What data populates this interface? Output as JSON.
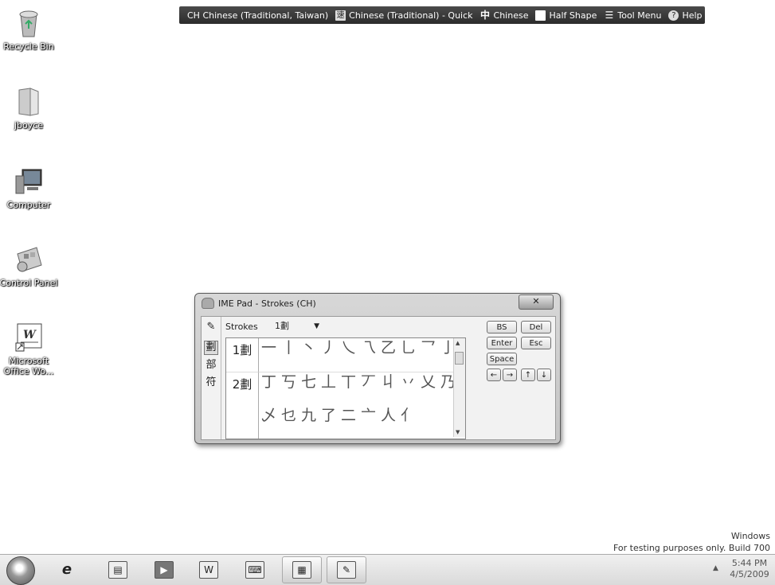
{
  "desktop": {
    "icons": [
      {
        "label": "Recycle Bin",
        "icon": "recycle-bin-icon"
      },
      {
        "label": "jboyce",
        "icon": "user-folder-icon"
      },
      {
        "label": "Computer",
        "icon": "computer-icon"
      },
      {
        "label": "Control Panel",
        "icon": "control-panel-icon"
      },
      {
        "label": "Microsoft Office Wo...",
        "icon": "word-shortcut-icon"
      }
    ]
  },
  "langbar": {
    "items": [
      {
        "label": "CH Chinese (Traditional, Taiwan)",
        "icon": "keyboard-language-icon"
      },
      {
        "label": "Chinese (Traditional) - Quick",
        "icon": "ime-mode-icon",
        "glyph": "速"
      },
      {
        "label": "Chinese",
        "icon": "chinese-mode-icon",
        "glyph": "中"
      },
      {
        "label": "Half Shape",
        "icon": "half-shape-icon",
        "glyph": " "
      },
      {
        "label": "Tool Menu",
        "icon": "tool-menu-icon",
        "glyph": "☰"
      },
      {
        "label": "Help",
        "icon": "help-icon",
        "glyph": "?"
      }
    ],
    "options_glyph": "⁝"
  },
  "imepad": {
    "title": "IME Pad - Strokes (CH)",
    "close_glyph": "✕",
    "tabs": [
      {
        "name": "handwriting",
        "glyph": "✎"
      },
      {
        "name": "strokes",
        "glyph": "劃"
      },
      {
        "name": "radical",
        "glyph": "部"
      },
      {
        "name": "symbols",
        "glyph": "符"
      }
    ],
    "strokes_label": "Strokes",
    "strokes_value": "1劃",
    "rows": [
      {
        "label": "1劃",
        "chars": [
          "一",
          "丨",
          "丶",
          "丿",
          "乀",
          "乁",
          "乙",
          "乚",
          "乛",
          "亅"
        ]
      },
      {
        "label": "2劃",
        "chars": [
          "丁",
          "丂",
          "七",
          "丄",
          "丅",
          "丆",
          "丩",
          "丷",
          "乂",
          "乃",
          "乄",
          "乜",
          "九",
          "了",
          "二",
          "亠",
          "人",
          "亻"
        ]
      }
    ],
    "keys": {
      "bs": "BS",
      "del": "Del",
      "enter": "Enter",
      "esc": "Esc",
      "space": "Space",
      "left": "←",
      "right": "→",
      "up": "↑",
      "down": "↓"
    }
  },
  "watermark": {
    "line1": "Windows",
    "line2": "For testing purposes only. Build 700"
  },
  "taskbar": {
    "items": [
      {
        "name": "internet-explorer",
        "glyph": "e"
      },
      {
        "name": "windows-explorer",
        "glyph": "▤"
      },
      {
        "name": "media-player",
        "glyph": "▶"
      },
      {
        "name": "microsoft-word",
        "glyph": "W"
      },
      {
        "name": "ime-app",
        "glyph": "⌨"
      },
      {
        "name": "control-panel",
        "glyph": "▦"
      },
      {
        "name": "ime-pad",
        "glyph": "✎"
      }
    ],
    "show_hidden_glyph": "▲",
    "clock_time": "5:44 PM",
    "clock_date": "4/5/2009"
  }
}
